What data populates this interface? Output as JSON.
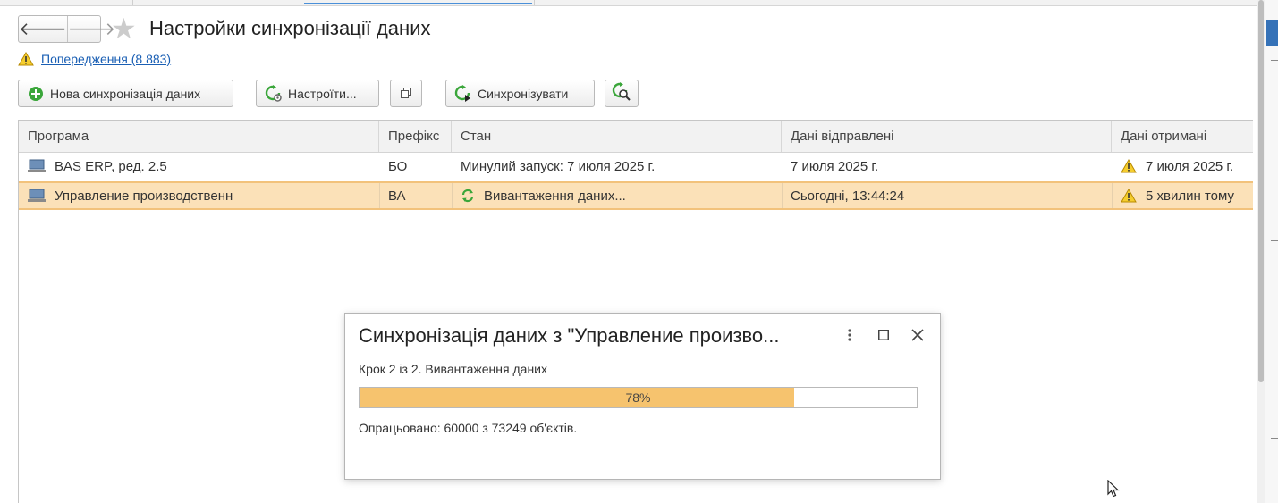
{
  "window": {
    "title": "Настройки синхронізації даних"
  },
  "nav": {
    "back_glyph": "🡐",
    "forward_glyph": "🡒"
  },
  "warnings": {
    "link_label": "Попередження (8 883)"
  },
  "toolbar": {
    "new_sync_label": "Нова синхронізація даних",
    "configure_label": "Настроїти...",
    "synchronize_label": "Синхронізувати"
  },
  "grid": {
    "columns": [
      "Програма",
      "Префікс",
      "Стан",
      "Дані відправлені",
      "Дані отримані"
    ],
    "rows": [
      {
        "program": "BAS ERP, ред. 2.5",
        "prefix": "БО",
        "state": "Минулий запуск: 7 июля 2025 г.",
        "sent": "7 июля 2025 г.",
        "received": "7 июля 2025 г.",
        "selected": false,
        "syncing": false
      },
      {
        "program": "Управление производственн",
        "prefix": "ВА",
        "state": "Вивантаження даних...",
        "sent": "Сьогодні, 13:44:24",
        "received": "5 хвилин тому",
        "selected": true,
        "syncing": true
      }
    ]
  },
  "dialog": {
    "title": "Синхронізація даних з \"Управление произво...",
    "step": "Крок 2 із 2. Вивантаження даних",
    "progress_percent": 78,
    "progress_label": "78%",
    "processed": "Опрацьовано: 60000 з 73249 об'єктів."
  },
  "colors": {
    "accent_link": "#1a5fb4",
    "selection": "#fbe1b8",
    "progress_fill": "#f6c36e",
    "sync_green": "#3aa63a"
  },
  "icons": [
    "arrow-left-icon",
    "arrow-right-icon",
    "star-icon",
    "warning-icon",
    "plus-circle-icon",
    "sync-settings-icon",
    "open-window-icon",
    "sync-icon",
    "search-sync-icon",
    "computer-icon",
    "refresh-icon",
    "more-icon",
    "maximize-icon",
    "close-icon",
    "cursor-icon"
  ]
}
